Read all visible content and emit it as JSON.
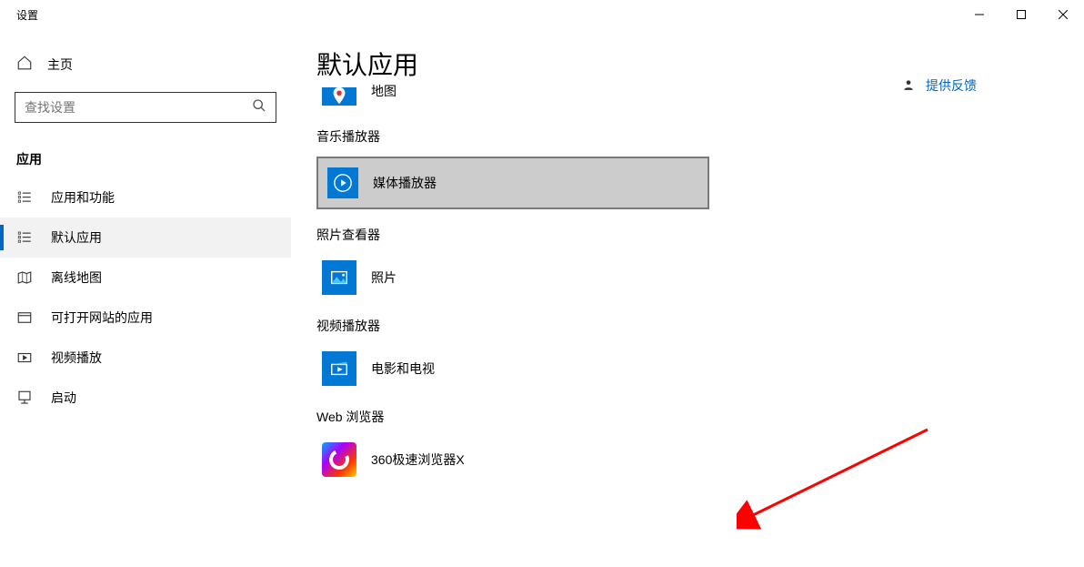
{
  "window": {
    "title": "设置"
  },
  "sidebar": {
    "home": "主页",
    "search_placeholder": "查找设置",
    "section": "应用",
    "items": [
      {
        "label": "应用和功能"
      },
      {
        "label": "默认应用"
      },
      {
        "label": "离线地图"
      },
      {
        "label": "可打开网站的应用"
      },
      {
        "label": "视频播放"
      },
      {
        "label": "启动"
      }
    ]
  },
  "main": {
    "title": "默认应用",
    "feedback": "提供反馈",
    "partial_top": {
      "label": "地图"
    },
    "groups": [
      {
        "label": "音乐播放器",
        "app": "媒体播放器",
        "hovered": true
      },
      {
        "label": "照片查看器",
        "app": "照片"
      },
      {
        "label": "视频播放器",
        "app": "电影和电视"
      },
      {
        "label": "Web 浏览器",
        "app": "360极速浏览器X"
      }
    ]
  }
}
